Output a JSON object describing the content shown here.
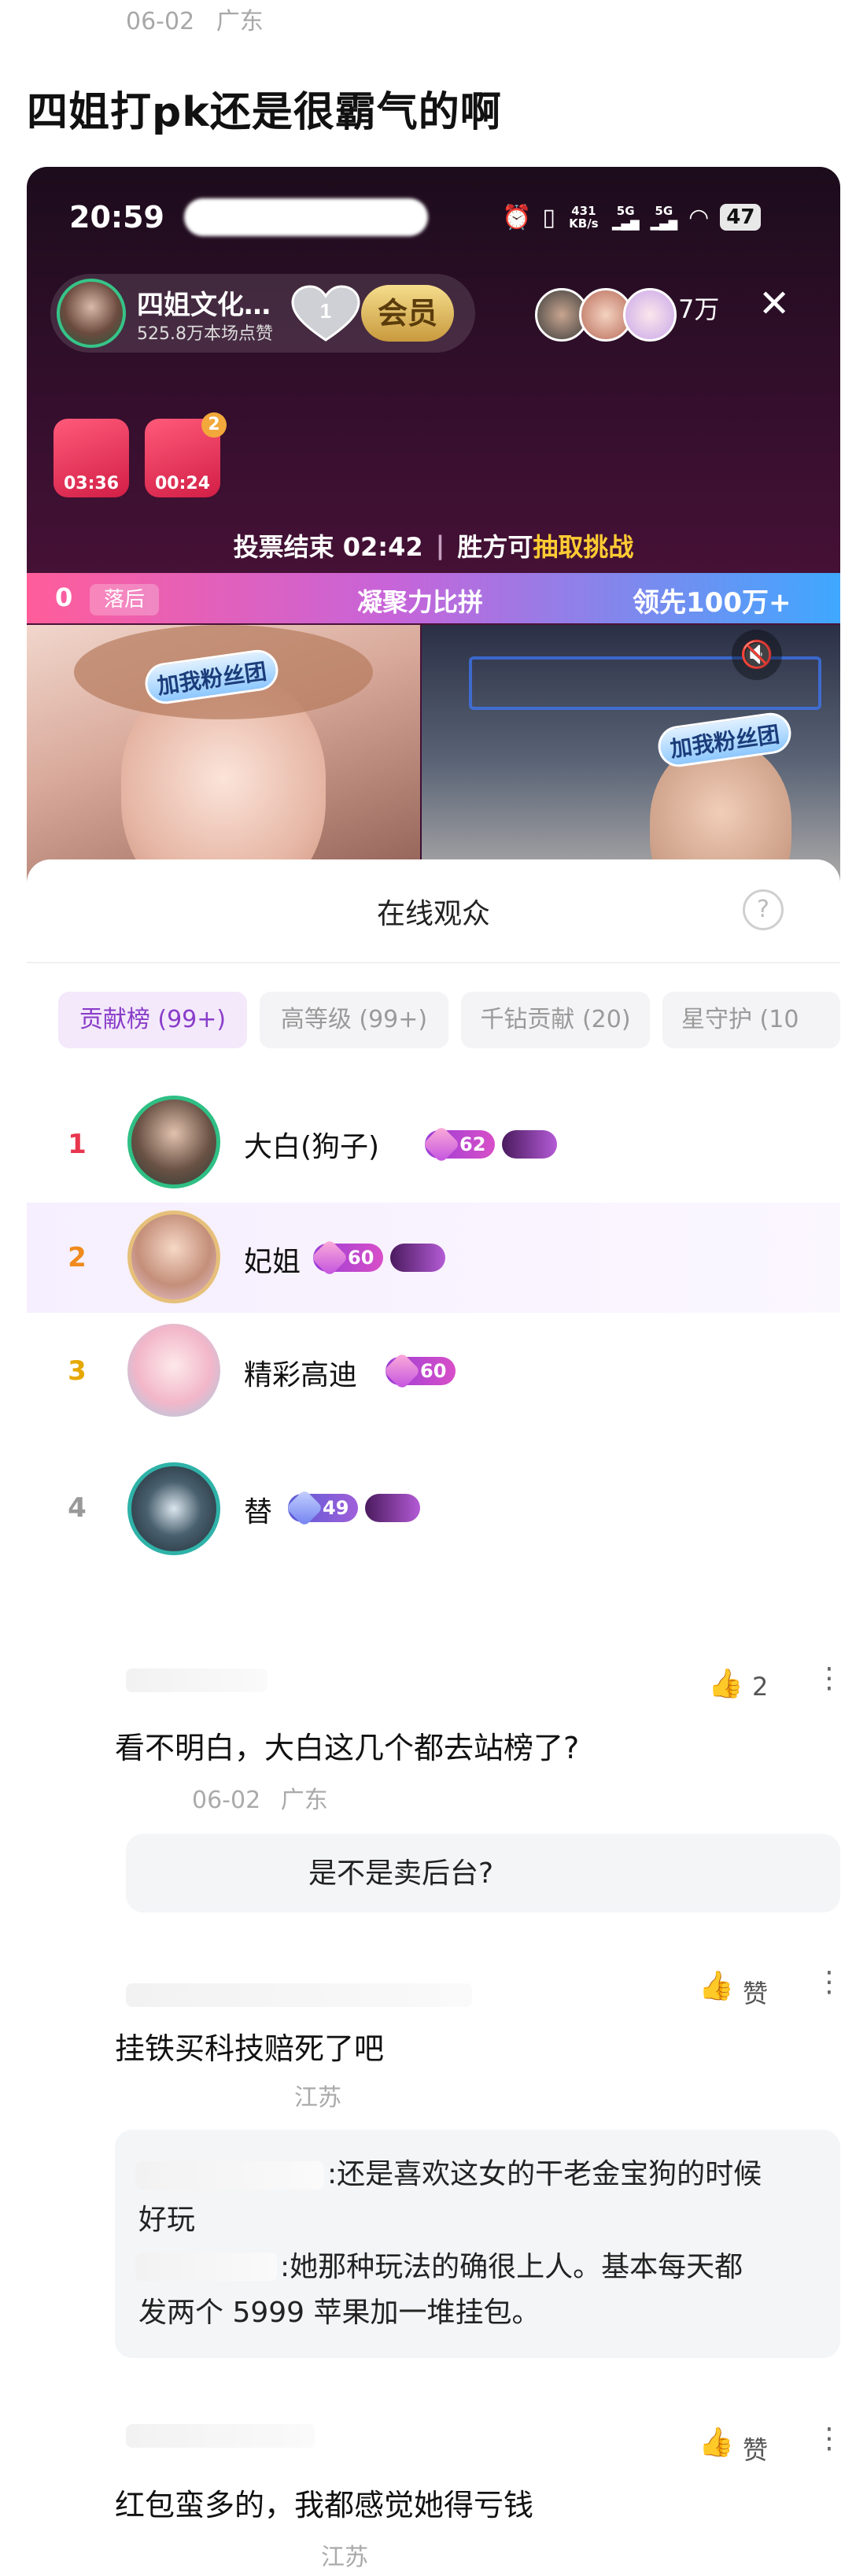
{
  "post": {
    "meta_date": "06-02",
    "meta_location": "广东",
    "title": "四姐打pk还是很霸气的啊"
  },
  "live": {
    "status_time": "20:59",
    "net_speed": "431 KB/s",
    "signal_a": "5G",
    "signal_b": "5G",
    "battery": "47",
    "host_name": "四姐文化…",
    "host_likes": "525.8万本场点赞",
    "heart_level": "1",
    "vip_label": "会员",
    "viewer_count": "7万",
    "close_label": "✕",
    "redpack_1_time": "03:36",
    "redpack_2_time": "00:24",
    "redpack_2_count": "2",
    "vote_prefix": "投票结束 02:42",
    "vote_sep": "|",
    "vote_mid": "胜方可",
    "vote_highlight": "抽取挑战",
    "pk_score_left": "0",
    "pk_status_left": "落后",
    "pk_title": "凝聚力比拼",
    "pk_status_right": "领先100万+",
    "fan_tag_left": "加我粉丝团",
    "fan_tag_right": "加我粉丝团"
  },
  "audience": {
    "title": "在线观众",
    "help": "?",
    "tabs": [
      {
        "label": "贡献榜 (99+)",
        "active": true
      },
      {
        "label": "高等级 (99+)",
        "active": false
      },
      {
        "label": "千钻贡献 (20)",
        "active": false
      },
      {
        "label": "星守护 (10",
        "active": false
      }
    ],
    "ranks": [
      {
        "rank": "1",
        "name": "大白(狗子)",
        "level": "62",
        "rank_color": "#e8364e"
      },
      {
        "rank": "2",
        "name": "妃姐",
        "level": "60",
        "rank_color": "#f08a1c"
      },
      {
        "rank": "3",
        "name": "精彩高迪",
        "level": "60",
        "rank_color": "#e6a800"
      },
      {
        "rank": "4",
        "name": "替",
        "level": "49",
        "rank_color": "#999999"
      }
    ]
  },
  "comments": [
    {
      "likes": "2",
      "text": "看不明白，大白这几个都去站榜了?",
      "meta_date": "06-02",
      "meta_location": "广东",
      "reply": "是不是卖后台?"
    },
    {
      "likes": "赞",
      "text": "挂铁买科技赔死了吧",
      "meta_location": "江苏",
      "reply_1_line1": ":还是喜欢这女的干老金宝狗的时候",
      "reply_1_line2": "好玩",
      "reply_2_line1": ":她那种玩法的确很上人。基本每天都",
      "reply_2_line2": "发两个 5999 苹果加一堆挂包。"
    },
    {
      "likes": "赞",
      "text": "红包蛮多的，我都感觉她得亏钱",
      "meta_location": "江苏"
    }
  ],
  "icons": {
    "like": "thumbs-up-icon",
    "more": "more-dots-icon",
    "mute": "mute-icon",
    "help": "help-icon"
  },
  "colors": {
    "accent_purple": "#8a3dc9",
    "pk_pink": "#ff5d9a",
    "pk_blue": "#3fa8ff",
    "vip_gold": "#c99a3e"
  }
}
